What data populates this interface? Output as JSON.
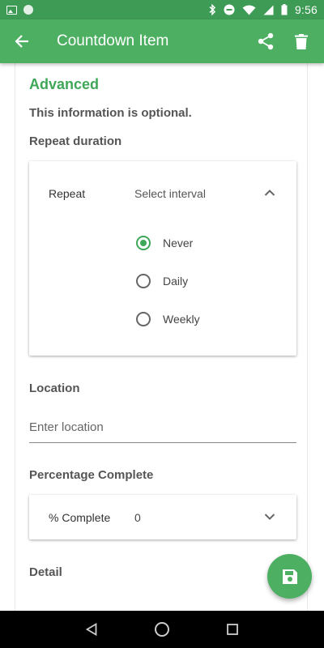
{
  "status_bar": {
    "time": "9:56",
    "icons": [
      "image-icon",
      "circle-icon",
      "bluetooth-icon",
      "do-not-disturb-icon",
      "wifi-icon",
      "signal-icon",
      "battery-icon"
    ]
  },
  "app_bar": {
    "title": "Countdown Item",
    "icons": [
      "back-arrow-icon",
      "share-icon",
      "delete-icon"
    ]
  },
  "advanced": {
    "heading": "Advanced",
    "note": "This information is optional."
  },
  "repeat": {
    "section_label": "Repeat duration",
    "field_label": "Repeat",
    "value": "Select interval",
    "options": [
      {
        "label": "Never",
        "selected": true
      },
      {
        "label": "Daily",
        "selected": false
      },
      {
        "label": "Weekly",
        "selected": false
      }
    ]
  },
  "location": {
    "section_label": "Location",
    "placeholder": "Enter location",
    "value": ""
  },
  "percentage": {
    "section_label": "Percentage Complete",
    "field_label": "% Complete",
    "value": "0"
  },
  "detail": {
    "section_label": "Detail"
  },
  "fab": {
    "icon": "save-icon"
  },
  "colors": {
    "accent": "#4caf62",
    "status_bar": "#3e9b56",
    "heading_green": "#3fa758"
  }
}
